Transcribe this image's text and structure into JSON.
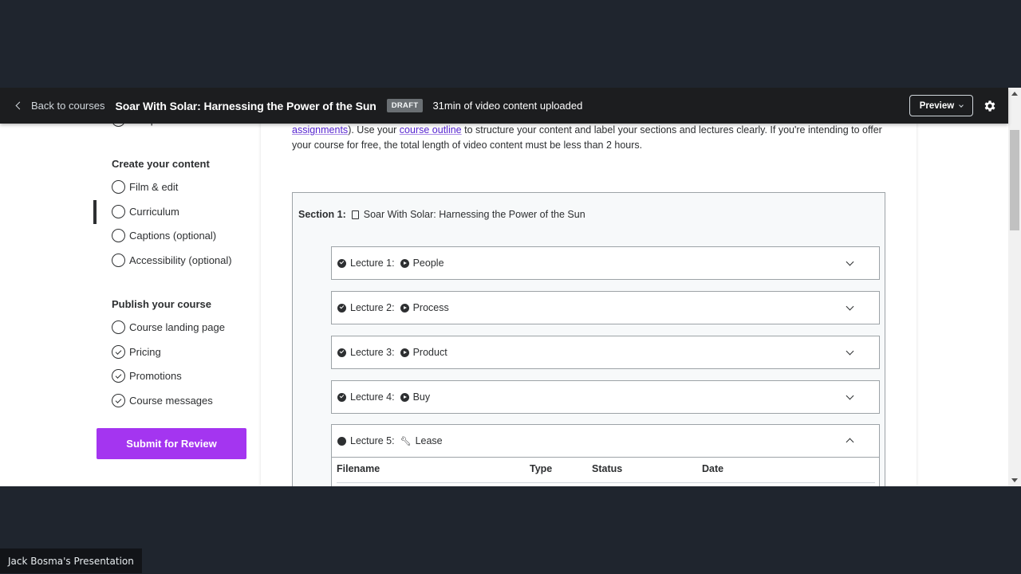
{
  "header": {
    "back_label": "Back to courses",
    "course_title": "Soar With Solar: Harnessing the Power of the Sun",
    "status_badge": "DRAFT",
    "upload_status": "31min of video content uploaded",
    "preview_label": "Preview",
    "settings_icon": "gear-icon"
  },
  "sidebar": {
    "partial_item": "Setup & test video",
    "sections": [
      {
        "heading": "Create your content",
        "items": [
          {
            "label": "Film & edit",
            "state": "incomplete"
          },
          {
            "label": "Curriculum",
            "state": "incomplete",
            "active": true
          },
          {
            "label": "Captions (optional)",
            "state": "incomplete"
          },
          {
            "label": "Accessibility (optional)",
            "state": "incomplete"
          }
        ]
      },
      {
        "heading": "Publish your course",
        "items": [
          {
            "label": "Course landing page",
            "state": "incomplete"
          },
          {
            "label": "Pricing",
            "state": "complete"
          },
          {
            "label": "Promotions",
            "state": "complete"
          },
          {
            "label": "Course messages",
            "state": "complete"
          }
        ]
      }
    ],
    "submit_label": "Submit for Review"
  },
  "main": {
    "intro": {
      "link1": "assignments",
      "text1": "). Use your ",
      "link2": "course outline",
      "text2": " to structure your content and label your sections and lectures clearly. If you're intending to offer your course for free, the total length of video content must be less than 2 hours."
    },
    "section": {
      "label": "Section 1:",
      "title": "Soar With Solar: Harnessing the Power of the Sun",
      "lectures": [
        {
          "label": "Lecture 1:",
          "title": "People",
          "icon": "play-circle-icon",
          "expanded": false
        },
        {
          "label": "Lecture 2:",
          "title": "Process",
          "icon": "play-circle-icon",
          "expanded": false
        },
        {
          "label": "Lecture 3:",
          "title": "Product",
          "icon": "play-circle-icon",
          "expanded": false
        },
        {
          "label": "Lecture 4:",
          "title": "Buy",
          "icon": "play-circle-icon",
          "expanded": false
        },
        {
          "label": "Lecture 5:",
          "title": "Lease",
          "icon": "wrench-icon",
          "expanded": true
        }
      ],
      "files_table": {
        "columns": [
          "Filename",
          "Type",
          "Status",
          "Date"
        ]
      }
    }
  },
  "presenter": {
    "label": "Jack Bosma's Presentation"
  },
  "colors": {
    "brand_purple": "#a435f0",
    "link_purple": "#5624d0",
    "header_bg": "#1c1d1f"
  }
}
